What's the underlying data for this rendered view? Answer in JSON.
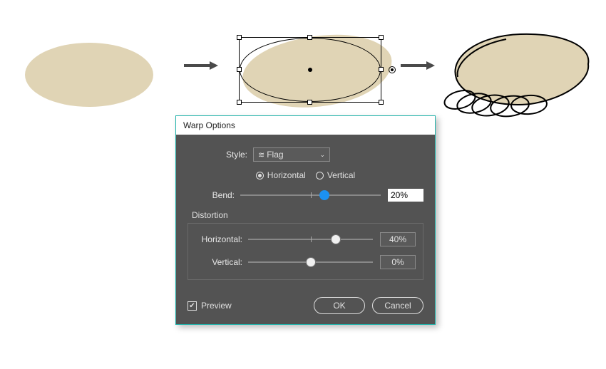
{
  "dialog": {
    "title": "Warp Options",
    "style_label": "Style:",
    "style_value": "Flag",
    "orientation": {
      "horizontal_label": "Horizontal",
      "vertical_label": "Vertical",
      "selected": "Horizontal"
    },
    "bend": {
      "label": "Bend:",
      "value": "20%",
      "percent": 20
    },
    "distortion": {
      "title": "Distortion",
      "horizontal": {
        "label": "Horizontal:",
        "value": "40%",
        "percent": 40
      },
      "vertical": {
        "label": "Vertical:",
        "value": "0%",
        "percent": 0
      }
    },
    "preview_label": "Preview",
    "preview_checked": true,
    "ok_label": "OK",
    "cancel_label": "Cancel"
  },
  "illustration": {
    "steps": [
      "ellipse-original",
      "ellipse-bounding-box",
      "warped-hand-result"
    ]
  }
}
